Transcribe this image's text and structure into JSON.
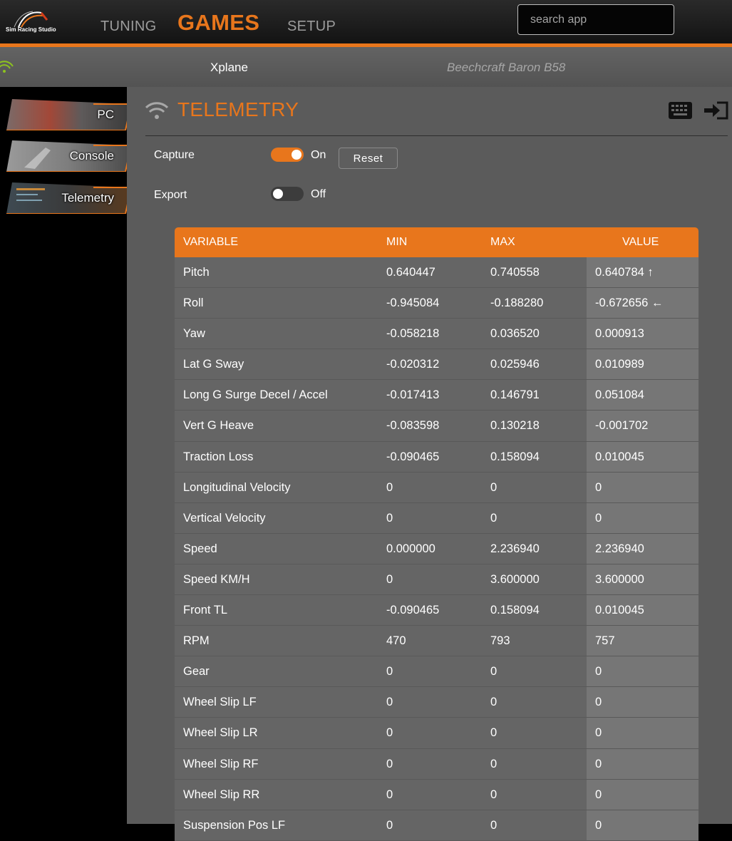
{
  "header": {
    "logo_text": "Sim Racing Studio",
    "nav": {
      "tuning": "TUNING",
      "games": "GAMES",
      "setup": "SETUP"
    },
    "search_placeholder": "search app",
    "accent_color": "#e8761c"
  },
  "subheader": {
    "game": "Xplane",
    "aircraft": "Beechcraft Baron B58"
  },
  "sidebar": {
    "items": [
      {
        "label": "PC"
      },
      {
        "label": "Console"
      },
      {
        "label": "Telemetry"
      }
    ]
  },
  "telemetry": {
    "title": "TELEMETRY",
    "capture_label": "Capture",
    "capture_state": "On",
    "reset_label": "Reset",
    "export_label": "Export",
    "export_state": "Off"
  },
  "table": {
    "columns": [
      "VARIABLE",
      "MIN",
      "MAX",
      "VALUE"
    ],
    "rows": [
      [
        "Pitch",
        "0.640447",
        "0.740558",
        "0.640784 ↑"
      ],
      [
        "Roll",
        "-0.945084",
        "-0.188280",
        "-0.672656 ←"
      ],
      [
        "Yaw",
        "-0.058218",
        "0.036520",
        "0.000913"
      ],
      [
        "Lat G Sway",
        "-0.020312",
        "0.025946",
        "0.010989"
      ],
      [
        "Long G Surge Decel / Accel",
        "-0.017413",
        "0.146791",
        "0.051084"
      ],
      [
        "Vert G Heave",
        "-0.083598",
        "0.130218",
        "-0.001702"
      ],
      [
        "Traction Loss",
        "-0.090465",
        "0.158094",
        "0.010045"
      ],
      [
        "Longitudinal Velocity",
        "0",
        "0",
        "0"
      ],
      [
        "Vertical Velocity",
        "0",
        "0",
        "0"
      ],
      [
        "Speed",
        "0.000000",
        "2.236940",
        "2.236940"
      ],
      [
        "Speed KM/H",
        "0",
        "3.600000",
        "3.600000"
      ],
      [
        "Front TL",
        "-0.090465",
        "0.158094",
        "0.010045"
      ],
      [
        "RPM",
        "470",
        "793",
        "757"
      ],
      [
        "Gear",
        "0",
        "0",
        "0"
      ],
      [
        "Wheel Slip LF",
        "0",
        "0",
        "0"
      ],
      [
        "Wheel Slip LR",
        "0",
        "0",
        "0"
      ],
      [
        "Wheel Slip RF",
        "0",
        "0",
        "0"
      ],
      [
        "Wheel Slip RR",
        "0",
        "0",
        "0"
      ],
      [
        "Suspension Pos LF",
        "0",
        "0",
        "0"
      ]
    ]
  }
}
